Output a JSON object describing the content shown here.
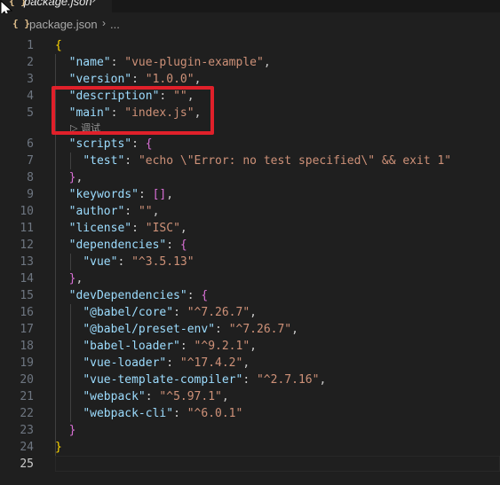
{
  "tab": {
    "icon": "{ }",
    "title": "package.json",
    "close": "›"
  },
  "breadcrumb": {
    "icon": "{ }",
    "file": "package.json",
    "separator": "›",
    "more": "..."
  },
  "codelens": {
    "label": "调试"
  },
  "lines": [
    {
      "n": "1",
      "code": [
        [
          "b1",
          "{"
        ]
      ]
    },
    {
      "n": "2",
      "code": [
        [
          "p",
          "  "
        ],
        [
          "k",
          "\"name\""
        ],
        [
          "p",
          ": "
        ],
        [
          "s",
          "\"vue-plugin-example\""
        ],
        [
          "p",
          ","
        ]
      ]
    },
    {
      "n": "3",
      "code": [
        [
          "p",
          "  "
        ],
        [
          "k",
          "\"version\""
        ],
        [
          "p",
          ": "
        ],
        [
          "s",
          "\"1.0.0\""
        ],
        [
          "p",
          ","
        ]
      ]
    },
    {
      "n": "4",
      "code": [
        [
          "p",
          "  "
        ],
        [
          "k",
          "\"description\""
        ],
        [
          "p",
          ": "
        ],
        [
          "s",
          "\"\""
        ],
        [
          "p",
          ","
        ]
      ]
    },
    {
      "n": "5",
      "code": [
        [
          "p",
          "  "
        ],
        [
          "k",
          "\"main\""
        ],
        [
          "p",
          ": "
        ],
        [
          "s",
          "\"index.js\""
        ],
        [
          "p",
          ","
        ]
      ]
    },
    {
      "n": "6",
      "code": [
        [
          "p",
          "  "
        ],
        [
          "k",
          "\"scripts\""
        ],
        [
          "p",
          ": "
        ],
        [
          "b2",
          "{"
        ]
      ]
    },
    {
      "n": "7",
      "code": [
        [
          "p",
          "    "
        ],
        [
          "k",
          "\"test\""
        ],
        [
          "p",
          ": "
        ],
        [
          "s",
          "\"echo \\\"Error: no test specified\\\" && exit 1\""
        ]
      ]
    },
    {
      "n": "8",
      "code": [
        [
          "p",
          "  "
        ],
        [
          "b2",
          "}"
        ],
        [
          "p",
          ","
        ]
      ]
    },
    {
      "n": "9",
      "code": [
        [
          "p",
          "  "
        ],
        [
          "k",
          "\"keywords\""
        ],
        [
          "p",
          ": "
        ],
        [
          "b2",
          "[]"
        ],
        [
          "p",
          ","
        ]
      ]
    },
    {
      "n": "10",
      "code": [
        [
          "p",
          "  "
        ],
        [
          "k",
          "\"author\""
        ],
        [
          "p",
          ": "
        ],
        [
          "s",
          "\"\""
        ],
        [
          "p",
          ","
        ]
      ]
    },
    {
      "n": "11",
      "code": [
        [
          "p",
          "  "
        ],
        [
          "k",
          "\"license\""
        ],
        [
          "p",
          ": "
        ],
        [
          "s",
          "\"ISC\""
        ],
        [
          "p",
          ","
        ]
      ]
    },
    {
      "n": "12",
      "code": [
        [
          "p",
          "  "
        ],
        [
          "k",
          "\"dependencies\""
        ],
        [
          "p",
          ": "
        ],
        [
          "b2",
          "{"
        ]
      ]
    },
    {
      "n": "13",
      "code": [
        [
          "p",
          "    "
        ],
        [
          "k",
          "\"vue\""
        ],
        [
          "p",
          ": "
        ],
        [
          "s",
          "\"^3.5.13\""
        ]
      ]
    },
    {
      "n": "14",
      "code": [
        [
          "p",
          "  "
        ],
        [
          "b2",
          "}"
        ],
        [
          "p",
          ","
        ]
      ]
    },
    {
      "n": "15",
      "code": [
        [
          "p",
          "  "
        ],
        [
          "k",
          "\"devDependencies\""
        ],
        [
          "p",
          ": "
        ],
        [
          "b2",
          "{"
        ]
      ]
    },
    {
      "n": "16",
      "code": [
        [
          "p",
          "    "
        ],
        [
          "k",
          "\"@babel/core\""
        ],
        [
          "p",
          ": "
        ],
        [
          "s",
          "\"^7.26.7\""
        ],
        [
          "p",
          ","
        ]
      ]
    },
    {
      "n": "17",
      "code": [
        [
          "p",
          "    "
        ],
        [
          "k",
          "\"@babel/preset-env\""
        ],
        [
          "p",
          ": "
        ],
        [
          "s",
          "\"^7.26.7\""
        ],
        [
          "p",
          ","
        ]
      ]
    },
    {
      "n": "18",
      "code": [
        [
          "p",
          "    "
        ],
        [
          "k",
          "\"babel-loader\""
        ],
        [
          "p",
          ": "
        ],
        [
          "s",
          "\"^9.2.1\""
        ],
        [
          "p",
          ","
        ]
      ]
    },
    {
      "n": "19",
      "code": [
        [
          "p",
          "    "
        ],
        [
          "k",
          "\"vue-loader\""
        ],
        [
          "p",
          ": "
        ],
        [
          "s",
          "\"^17.4.2\""
        ],
        [
          "p",
          ","
        ]
      ]
    },
    {
      "n": "20",
      "code": [
        [
          "p",
          "    "
        ],
        [
          "k",
          "\"vue-template-compiler\""
        ],
        [
          "p",
          ": "
        ],
        [
          "s",
          "\"^2.7.16\""
        ],
        [
          "p",
          ","
        ]
      ]
    },
    {
      "n": "21",
      "code": [
        [
          "p",
          "    "
        ],
        [
          "k",
          "\"webpack\""
        ],
        [
          "p",
          ": "
        ],
        [
          "s",
          "\"^5.97.1\""
        ],
        [
          "p",
          ","
        ]
      ]
    },
    {
      "n": "22",
      "code": [
        [
          "p",
          "    "
        ],
        [
          "k",
          "\"webpack-cli\""
        ],
        [
          "p",
          ": "
        ],
        [
          "s",
          "\"^6.0.1\""
        ]
      ]
    },
    {
      "n": "23",
      "code": [
        [
          "p",
          "  "
        ],
        [
          "b2",
          "}"
        ]
      ]
    },
    {
      "n": "24",
      "code": [
        [
          "b1",
          "}"
        ]
      ]
    },
    {
      "n": "25",
      "code": []
    }
  ],
  "active_line": "25",
  "colors": {
    "key": "#9cdcfe",
    "string": "#ce9178",
    "bracket1": "#ffd700",
    "bracket2": "#da70d6",
    "highlight": "#e0202a"
  }
}
